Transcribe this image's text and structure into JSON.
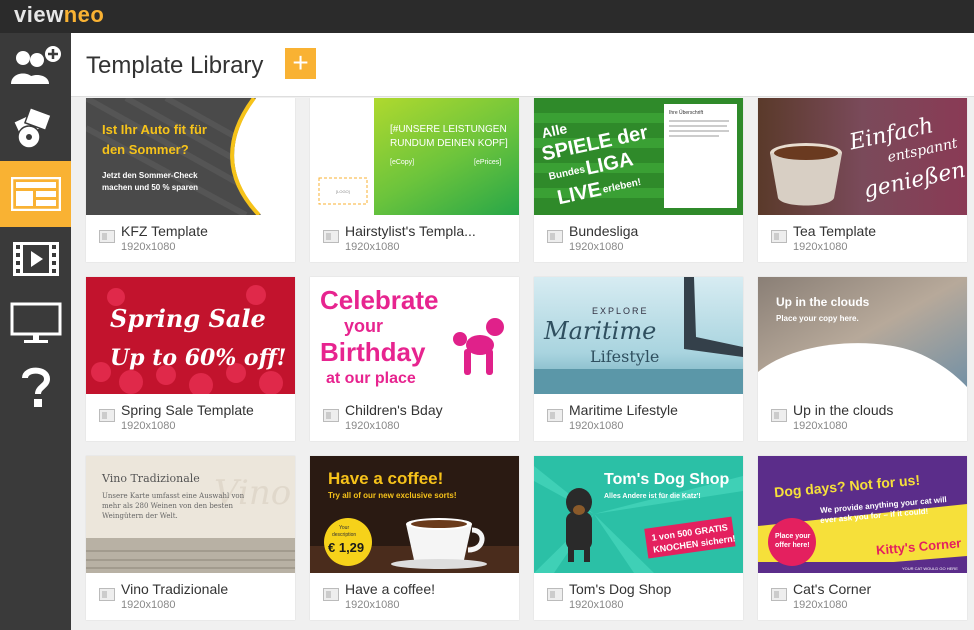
{
  "app": {
    "logo_part1": "view",
    "logo_part2": "neo"
  },
  "sidebar": [
    {
      "id": "users",
      "icon": "add-user-icon"
    },
    {
      "id": "media",
      "icon": "media-icon"
    },
    {
      "id": "templates",
      "icon": "layout-icon",
      "active": true
    },
    {
      "id": "playlists",
      "icon": "film-icon"
    },
    {
      "id": "displays",
      "icon": "monitor-icon"
    },
    {
      "id": "help",
      "icon": "help-icon"
    }
  ],
  "header": {
    "title": "Template Library",
    "add_label": "+"
  },
  "templates": [
    {
      "name": "KFZ Template",
      "size": "1920x1080",
      "thumb": {
        "lines": [
          "Ist Ihr Auto fit für",
          "den Sommer?",
          "Jetzt den Sommer-Check",
          "machen und 50 % sparen"
        ]
      }
    },
    {
      "name": "Hairstylist's Templa...",
      "size": "1920x1080",
      "thumb": {
        "lines": [
          "[#UNSERE LEISTUNGEN",
          "RUNDUM DEINEN KOPF]",
          "[eCopy]",
          "[ePrices]",
          "[LOGO]"
        ]
      }
    },
    {
      "name": "Bundesliga",
      "size": "1920x1080",
      "thumb": {
        "lines": [
          "Alle",
          "SPIELE der",
          "Bundes",
          "LIGA",
          "LIVE",
          "erleben!",
          "Ihre Überschrift"
        ]
      }
    },
    {
      "name": "Tea Template",
      "size": "1920x1080",
      "thumb": {
        "lines": [
          "Einfach",
          "entspannt",
          "genießen!"
        ]
      }
    },
    {
      "name": "Spring Sale Template",
      "size": "1920x1080",
      "thumb": {
        "lines": [
          "Spring Sale",
          "Up to 60% off!"
        ]
      }
    },
    {
      "name": "Children's Bday",
      "size": "1920x1080",
      "thumb": {
        "lines": [
          "Celebrate",
          "your",
          "Birthday",
          "at our place"
        ]
      }
    },
    {
      "name": "Maritime Lifestyle",
      "size": "1920x1080",
      "thumb": {
        "lines": [
          "EXPLORE",
          "Maritime",
          "Lifestyle"
        ]
      }
    },
    {
      "name": "Up in the clouds",
      "size": "1920x1080",
      "thumb": {
        "lines": [
          "Up in the clouds",
          "Place your copy here."
        ]
      }
    },
    {
      "name": "Vino Tradizionale",
      "size": "1920x1080",
      "thumb": {
        "lines": [
          "Vino Tradizionale",
          "Unsere Karte umfasst eine Auswahl von",
          "mehr als 280 Weinen von den besten",
          "Weingütern der Welt."
        ]
      }
    },
    {
      "name": "Have a coffee!",
      "size": "1920x1080",
      "thumb": {
        "lines": [
          "Have a coffee!",
          "Try all of our new exclusive sorts!",
          "€ 1,29",
          "Your",
          "description"
        ]
      }
    },
    {
      "name": "Tom's Dog Shop",
      "size": "1920x1080",
      "thumb": {
        "lines": [
          "Tom's Dog Shop",
          "Alles Andere ist für die Katz'!",
          "1 von 500 GRATIS",
          "KNOCHEN sichern!"
        ]
      }
    },
    {
      "name": "Cat's Corner",
      "size": "1920x1080",
      "thumb": {
        "lines": [
          "Dog days? Not for us!",
          "We provide anything your cat will",
          "ever ask you for – if it could!",
          "Kitty's Corner",
          "Place your",
          "offer here!",
          "YOUR CAT WOULD GO HERE"
        ]
      }
    }
  ],
  "colors": {
    "accent": "#f9b233",
    "sidebar": "#3a3a3a",
    "topbar": "#2b2b2b"
  }
}
